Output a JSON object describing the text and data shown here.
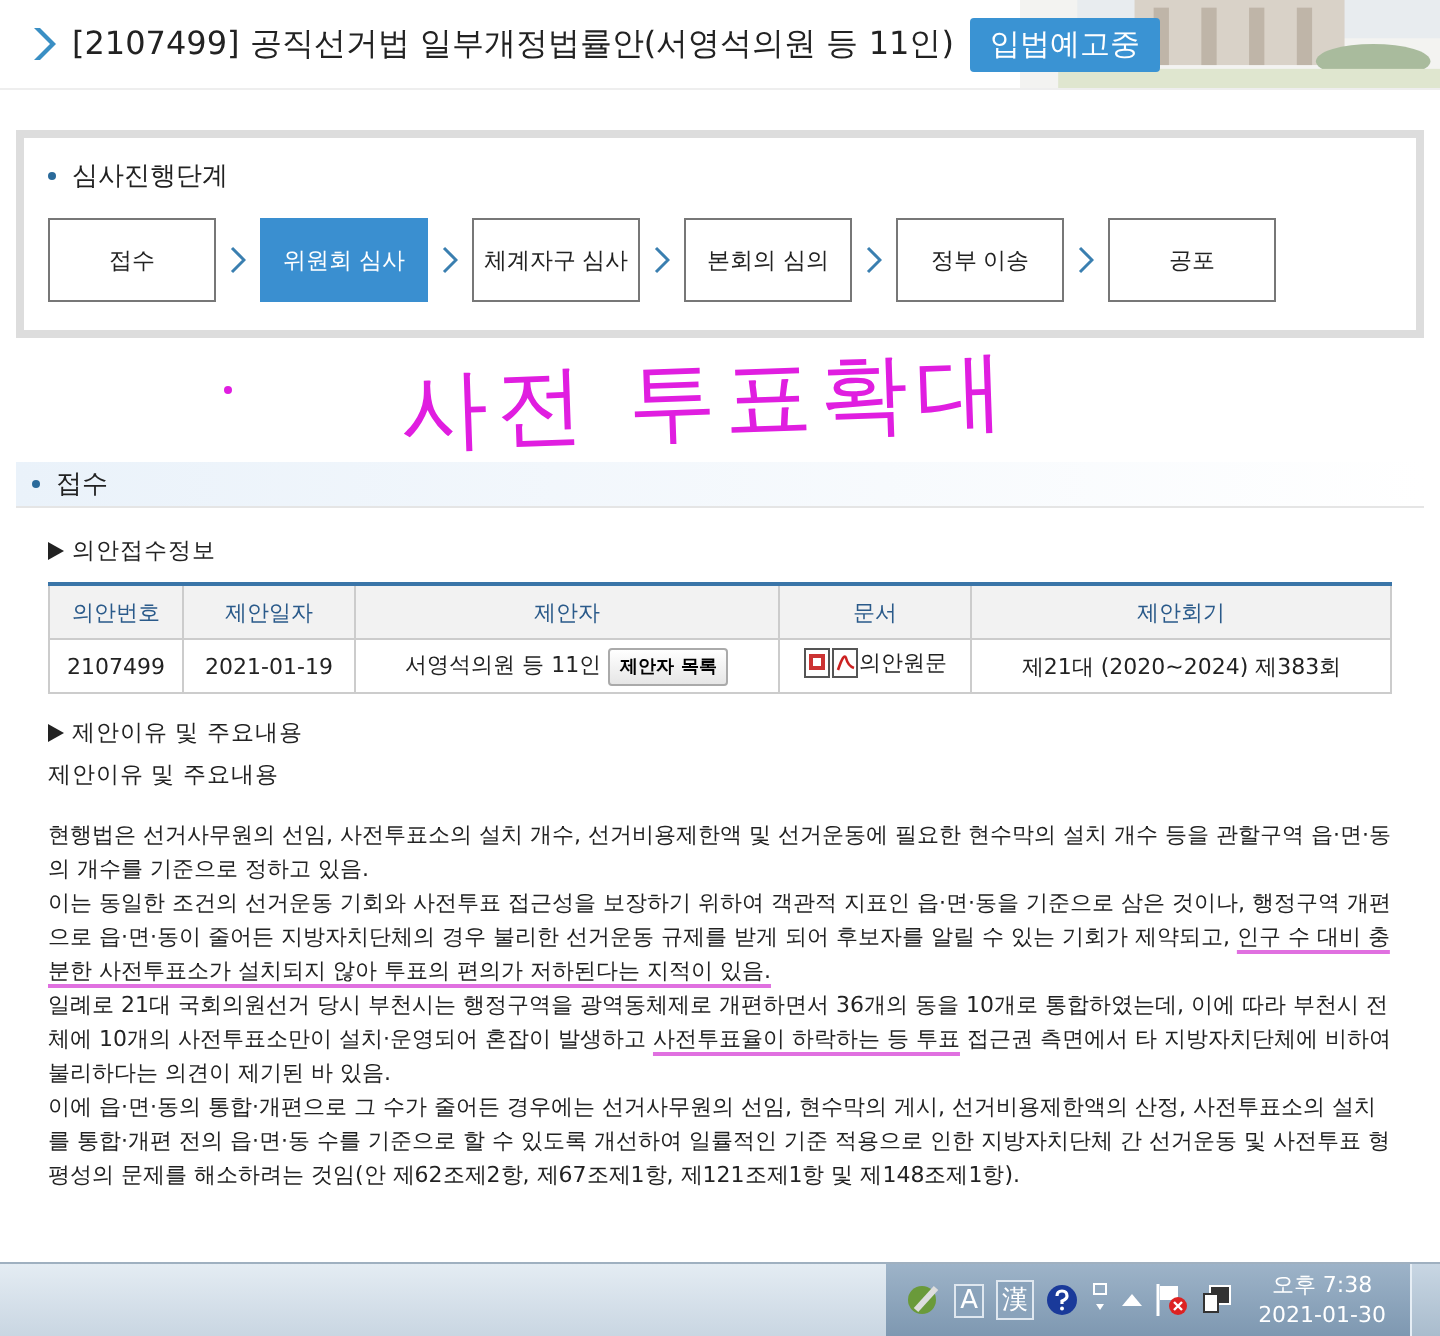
{
  "header": {
    "title": "[2107499] 공직선거법 일부개정법률안(서영석의원 등 11인)",
    "badge": "입법예고중"
  },
  "stages": {
    "heading": "심사진행단계",
    "items": [
      {
        "label": "접수",
        "selected": false
      },
      {
        "label": "위원회 심사",
        "selected": true
      },
      {
        "label": "체계자구 심사",
        "selected": false
      },
      {
        "label": "본회의 심의",
        "selected": false
      },
      {
        "label": "정부 이송",
        "selected": false
      },
      {
        "label": "공포",
        "selected": false
      }
    ]
  },
  "annotation": "사전 투표확대",
  "section": {
    "title": "접수"
  },
  "receipt": {
    "heading": "의안접수정보",
    "columns": [
      "의안번호",
      "제안일자",
      "제안자",
      "문서",
      "제안회기"
    ],
    "row": {
      "number": "2107499",
      "date": "2021-01-19",
      "proposer": "서영석의원 등 11인",
      "proposer_button": "제안자 목록",
      "document": "의안원문",
      "session": "제21대 (2020~2024) 제383회"
    }
  },
  "reasons": {
    "heading": "제안이유 및 주요내용",
    "subheading": "제안이유 및 주요내용",
    "paragraphs": [
      [
        {
          "text": "현행법은 선거사무원의 선임, 사전투표소의 설치 개수, 선거비용제한액 및 선거운동에 필요한 현수막의 설치 개수 등을 관할구역 읍·면·동의 개수를 기준으로 정하고 있음.",
          "underlined": false
        }
      ],
      [
        {
          "text": "이는 동일한 조건의 선거운동 기회와 사전투표 접근성을 보장하기 위하여 객관적 지표인 읍·면·동을 기준으로 삼은 것이나, 행정구역 개편으로 읍·면·동이 줄어든 지방자치단체의 경우 불리한 선거운동 규제를 받게 되어 후보자를 알릴 수 있는 기회가 제약되고, ",
          "underlined": false
        },
        {
          "text": "인구 수 대비 충분한 사전투표소가 설치되지 않아 투표의 편의가 저하된다는 지적이 있음.",
          "underlined": true
        }
      ],
      [
        {
          "text": "일례로 21대 국회의원선거 당시 부천시는 행정구역을 광역동체제로 개편하면서 36개의 동을 10개로 통합하였는데, 이에 따라 부천시 전체에 10개의 사전투표소만이 설치·운영되어 혼잡이 발생하고 ",
          "underlined": false
        },
        {
          "text": "사전투표율이 하락하는 등 투표",
          "underlined": true
        },
        {
          "text": " 접근권 측면에서 타 지방자치단체에 비하여 불리하다는 의견이 제기된 바 있음.",
          "underlined": false
        }
      ],
      [
        {
          "text": "이에 읍·면·동의 통합·개편으로 그 수가 줄어든 경우에는 선거사무원의 선임, 현수막의 게시, 선거비용제한액의 산정, 사전투표소의 설치를 통합·개편 전의 읍·면·동 수를 기준으로 할 수 있도록 개선하여 일률적인 기준 적용으로 인한 지방자치단체 간 선거운동 및 사전투표 형평성의 문제를 해소하려는 것임(안 제62조제2항, 제67조제1항, 제121조제1항 및 제148조제1항).",
          "underlined": false
        }
      ]
    ]
  },
  "taskbar": {
    "ime": [
      "A",
      "漢"
    ],
    "time": "오후 7:38",
    "date": "2021-01-30"
  }
}
